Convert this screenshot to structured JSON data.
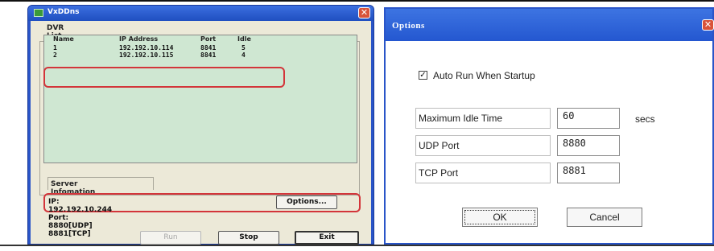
{
  "main_window": {
    "title": "VxDDns",
    "close_glyph": "✕",
    "dvr_list": {
      "group_label": "DVR List",
      "columns": [
        "Name",
        "IP Address",
        "Port",
        "Idle"
      ],
      "rows": [
        {
          "name": "1",
          "ip": "192.192.10.114",
          "port": "8841",
          "idle": "5"
        },
        {
          "name": "2",
          "ip": "192.192.10.115",
          "port": "8841",
          "idle": "4"
        }
      ]
    },
    "server_info": {
      "label": "Server Infomation",
      "text": "IP: 192.192.10.244  Port: 8880[UDP] 8881[TCP]",
      "options_button": "Options..."
    },
    "buttons": {
      "run": "Run",
      "stop": "Stop",
      "exit": "Exit"
    }
  },
  "options_dialog": {
    "title": "Options",
    "auto_run_checkbox": {
      "label": "Auto Run When Startup",
      "checked": true,
      "mark": "✓"
    },
    "fields": {
      "max_idle": {
        "label": "Maximum Idle Time",
        "value": "60",
        "unit": "secs"
      },
      "udp_port": {
        "label": "UDP Port",
        "value": "8880"
      },
      "tcp_port": {
        "label": "TCP Port",
        "value": "8881"
      }
    },
    "ok_button": "OK",
    "cancel_button": "Cancel"
  },
  "colors": {
    "titlebar_blue": "#2a55c8",
    "list_background": "#cfe7d2",
    "highlight_red": "#d3353a"
  }
}
